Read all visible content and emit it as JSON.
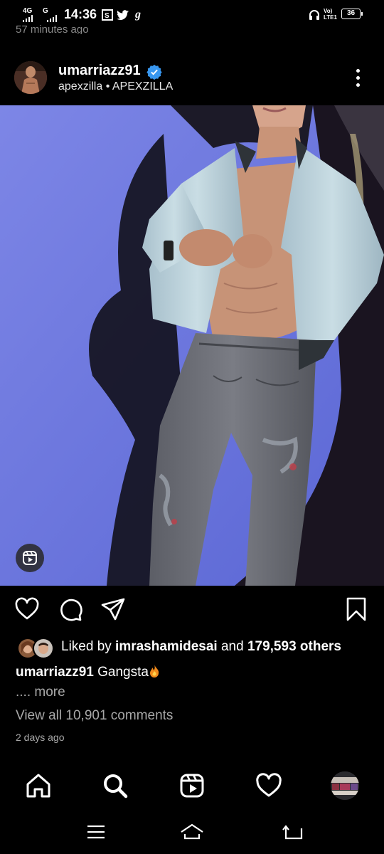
{
  "status_bar": {
    "network_1": "4G",
    "network_2": "G",
    "time": "14:36",
    "icons": [
      "notification-icon",
      "twitter-icon",
      "g-icon",
      "headphones-icon",
      "volte-icon",
      "battery-icon"
    ],
    "volte_label": "Vo) LTE1",
    "battery": "36"
  },
  "previous_post": {
    "timestamp": "57 minutes ago"
  },
  "post": {
    "username": "umarriazz91",
    "verified": true,
    "subline": "apexzilla • APEXZILLA",
    "media_type": "reel",
    "liked_by_prefix": "Liked by ",
    "liked_by_user": "imrashamidesai",
    "liked_by_mid": " and ",
    "liked_by_count": "179,593 others",
    "caption_user": "umarriazz91",
    "caption_text": "Gangsta",
    "more_label": ".... more",
    "view_comments": "View all 10,901 comments",
    "date": "2 days ago"
  },
  "colors": {
    "background": "#000000",
    "verified_blue": "#3897f0",
    "muted_text": "#a8a8a8",
    "media_backdrop": "#6e7be0"
  },
  "actions": [
    "like-icon",
    "comment-icon",
    "share-icon",
    "save-icon"
  ],
  "bottom_nav": [
    "home-icon",
    "search-icon",
    "reels-icon",
    "activity-icon",
    "profile-avatar"
  ],
  "system_nav": [
    "recents-icon",
    "home-icon",
    "back-icon"
  ]
}
